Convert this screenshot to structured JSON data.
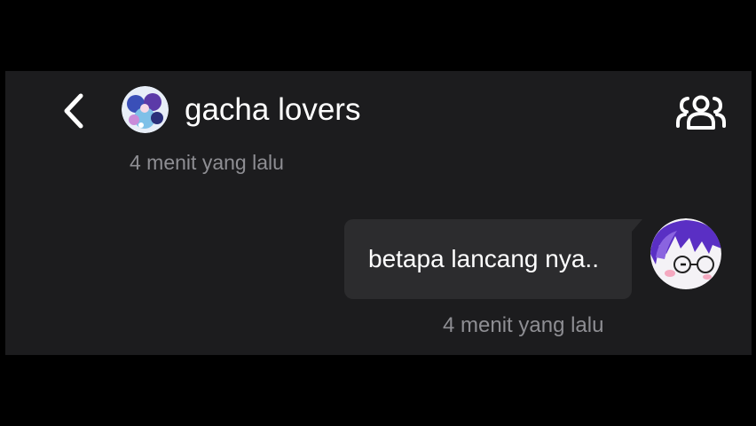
{
  "header": {
    "title": "gacha lovers",
    "back_icon": "chevron-left-icon",
    "members_icon": "group-members-icon",
    "group_avatar": "group-avatar-image"
  },
  "messages": [
    {
      "timestamp": "4 menit yang lalu",
      "text": "",
      "direction": "none"
    },
    {
      "text": "betapa lancang nya..",
      "timestamp": "4 menit yang lalu",
      "direction": "outgoing",
      "avatar": "user-avatar-image"
    }
  ],
  "colors": {
    "background": "#1c1c1e",
    "bubble": "#2c2c2e",
    "text": "#ffffff",
    "muted": "#8e8e93"
  }
}
